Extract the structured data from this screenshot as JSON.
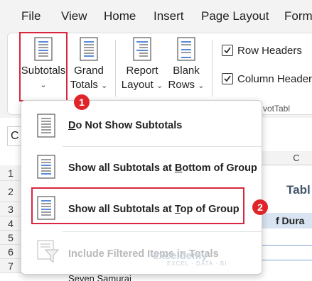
{
  "menu": {
    "items": [
      "File",
      "View",
      "Home",
      "Insert",
      "Page Layout",
      "Form"
    ]
  },
  "ribbon": {
    "subtotals": {
      "label": "Subtotals",
      "caret": "⌄"
    },
    "grand_totals": {
      "line1": "Grand",
      "line2": "Totals",
      "caret": "⌄"
    },
    "report_layout": {
      "line1": "Report",
      "line2": "Layout",
      "caret": "⌄"
    },
    "blank_rows": {
      "line1": "Blank",
      "line2": "Rows",
      "caret": "⌄"
    },
    "row_headers": {
      "label": "Row Headers",
      "checked": true
    },
    "column_headers": {
      "label": "Column Header",
      "checked": true
    },
    "group_label_fragment": "votTabl"
  },
  "dropdown": {
    "items": [
      {
        "pre": "",
        "accel": "D",
        "post": "o Not Show Subtotals",
        "enabled": true,
        "icon": "subtotals-none-icon"
      },
      {
        "pre": "Show all Subtotals at ",
        "accel": "B",
        "post": "ottom of Group",
        "enabled": true,
        "icon": "subtotals-bottom-icon"
      },
      {
        "pre": "Show all Subtotals at ",
        "accel": "T",
        "post": "op of Group",
        "enabled": true,
        "icon": "subtotals-top-icon"
      },
      {
        "pre": "Include Filtered Items in Totals",
        "accel": "",
        "post": "",
        "enabled": false,
        "icon": "filter-icon"
      }
    ]
  },
  "sheet": {
    "name_box": "C",
    "rows": [
      "1",
      "2",
      "3",
      "4",
      "5",
      "6",
      "7"
    ],
    "col_letter": "C",
    "cell_table_fragment": "Tabl",
    "cell_duration_fragment": "f Dura",
    "cell_row8": "Seven Samurai"
  },
  "callouts": [
    "1",
    "2"
  ],
  "watermark": {
    "name": "exceldemy",
    "tagline": "EXCEL · DATA · BI"
  },
  "colors": {
    "highlight": "#d7263d",
    "badge": "#e0252a",
    "icon_blue": "#2f6fd1",
    "icon_lines": "#5a5a5a"
  }
}
